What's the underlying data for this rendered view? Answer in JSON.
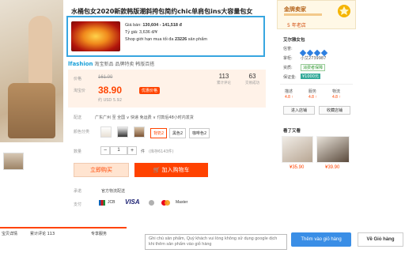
{
  "product": {
    "title": "水桶包女2020新款韩版潮斜挎包简约chic单肩包ins大容量包女",
    "translate": {
      "price_label": "Giá bán:",
      "price_value": "130,604 - 141,518 đ",
      "rate_label": "Tỷ giá:",
      "rate_value": "3,636 đ/¥",
      "limit_text_pre": "Shop giới hạn mua tối đa",
      "limit_value": "23226",
      "limit_text_post": "sản phẩm"
    },
    "brand_logo": "lfashion",
    "brand_tags": "淘宝新品  品牌特卖  韩版百搭",
    "price": {
      "orig_label": "价格",
      "orig_value": "161.00",
      "cur_label": "淘宝价",
      "cur_value": "38.90",
      "badge": "优惠价格",
      "usd": "约 USD 5.92",
      "stats": [
        {
          "num": "113",
          "label": "累计评论"
        },
        {
          "num": "63",
          "label": "交易成功"
        }
      ]
    },
    "shipping": {
      "label": "配送",
      "text": "广东广州 至  全国 ∨  快递 免运费  ∨  付款后48小时内发货"
    },
    "color": {
      "label": "颜色分类",
      "options": [
        "背奶2",
        "黑色2",
        "咖啡色2"
      ]
    },
    "qty": {
      "label": "数量",
      "value": "1",
      "minus": "−",
      "plus": "+",
      "unit": "件",
      "stock": "(库存6143件)"
    },
    "buttons": {
      "buy": "立即购买",
      "cart": "加入购物车"
    },
    "promise": {
      "label": "承诺",
      "text": "官方物流配送"
    },
    "pay": {
      "label": "支付",
      "methods": [
        "JCB",
        "VISA",
        "Master"
      ]
    }
  },
  "bottom_tabs": [
    "宝贝详情",
    "累计评论 113",
    "专享服务"
  ],
  "right": {
    "crown": "金牌卖家",
    "rating_tag": "5 年老店",
    "shop_name": "艾尔雅女包",
    "rows": [
      {
        "k": "信誉:",
        "v": ""
      },
      {
        "k": "掌柜:",
        "v": "小艾2739987"
      },
      {
        "k": "资质:",
        "v": "消费者保障"
      },
      {
        "k": "保证金:",
        "v": "¥1000元"
      }
    ],
    "scores": [
      {
        "k": "描述",
        "v": "4.8 ↑"
      },
      {
        "k": "服务",
        "v": "4.8 ↑"
      },
      {
        "k": "物流",
        "v": "4.8 ↑"
      }
    ],
    "btn_enter": "进入店铺",
    "btn_fav": "收藏店铺",
    "also_title": "看了又看",
    "also": [
      {
        "price": "¥35.90"
      },
      {
        "price": "¥39.90"
      }
    ]
  },
  "ext_bar": {
    "message": "Ghi chú sản phẩm, Quý khách vui lòng không sử dụng google dịch khi thêm sản phẩm vào giỏ hàng",
    "add_cart": "Thêm vào giỏ hàng",
    "home": "Về Giỏ hàng"
  }
}
